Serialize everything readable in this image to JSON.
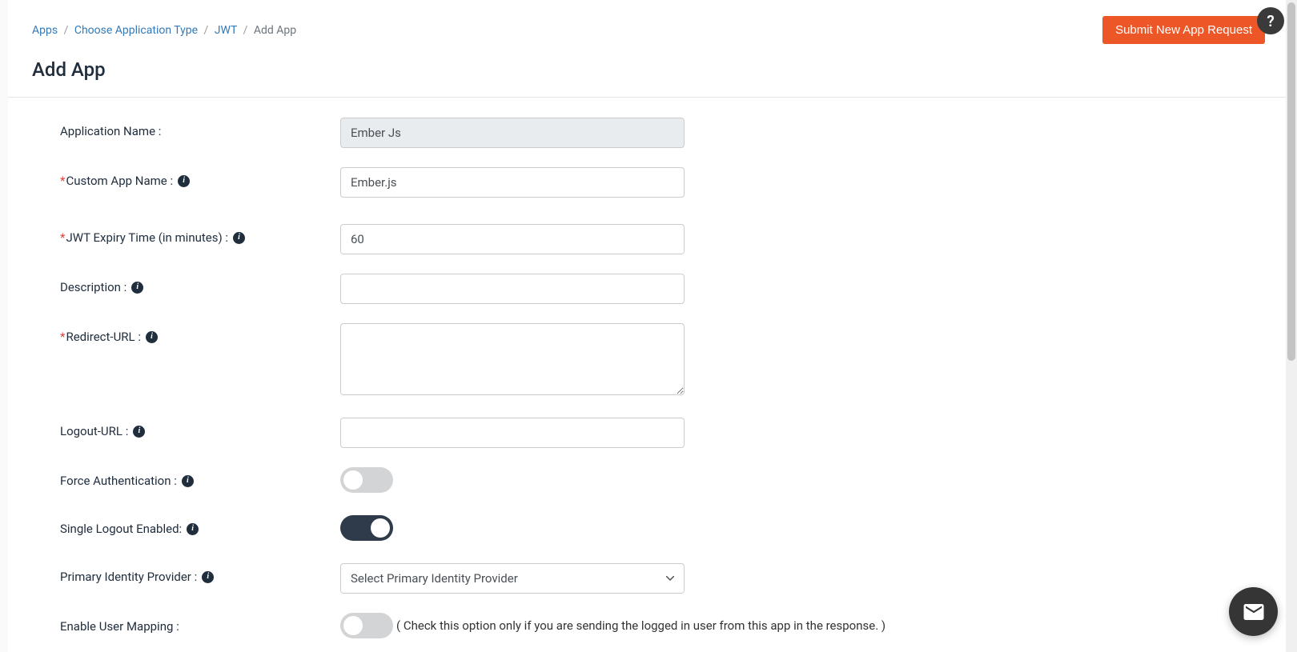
{
  "breadcrumb": {
    "apps": "Apps",
    "choose_type": "Choose Application Type",
    "jwt": "JWT",
    "current": "Add App"
  },
  "header": {
    "submit_button": "Submit New App Request"
  },
  "page_title": "Add App",
  "form": {
    "app_name": {
      "label": "Application Name :",
      "value": "Ember Js"
    },
    "custom_app_name": {
      "label": "Custom App Name :",
      "value": "Ember.js"
    },
    "jwt_expiry": {
      "label": "JWT Expiry Time (in minutes) :",
      "value": "60"
    },
    "description": {
      "label": "Description :",
      "value": ""
    },
    "redirect_url": {
      "label": "Redirect-URL :",
      "value": ""
    },
    "logout_url": {
      "label": "Logout-URL :",
      "value": ""
    },
    "force_auth": {
      "label": "Force Authentication :",
      "value": false
    },
    "single_logout": {
      "label": "Single Logout Enabled:",
      "value": true
    },
    "primary_idp": {
      "label": "Primary Identity Provider :",
      "placeholder": "Select Primary Identity Provider"
    },
    "user_mapping": {
      "label": "Enable User Mapping :",
      "value": false,
      "hint": "( Check this option only if you are sending the logged in user from this app in the response. )"
    }
  },
  "icons": {
    "help": "?",
    "info": "i"
  }
}
